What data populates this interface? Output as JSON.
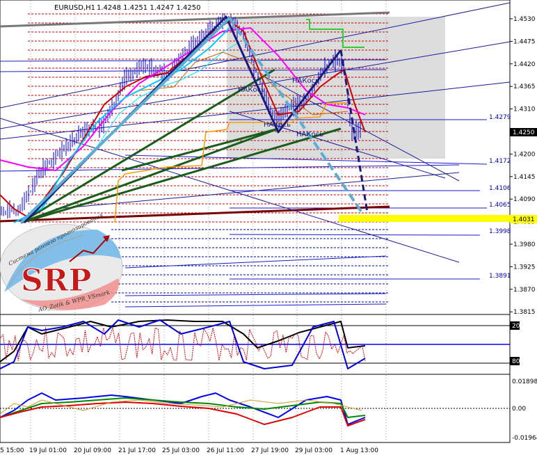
{
  "header": {
    "symbol": "EURUSD,H1",
    "quote": "1.4248 1.4251 1.4247 1.4250"
  },
  "logo": {
    "letters": "SRP",
    "ring_top": "Система раннего прогнозирования",
    "ring_bottom": "AO_Zotik & WPR_VSmark"
  },
  "annotations": {
    "nakos": [
      "НАКось",
      "НАКось",
      "НАКось",
      "НАКось"
    ]
  },
  "price_axis": {
    "ticks": [
      "1.4530",
      "1.4475",
      "1.4420",
      "1.4365",
      "1.4310",
      "1.4255",
      "1.4200",
      "1.4145",
      "1.4090",
      "1.4035",
      "1.3980",
      "1.3925",
      "1.3870",
      "1.3815"
    ],
    "current": "1.4250",
    "highlight": "1.4031"
  },
  "levels": [
    "1.4279",
    "1.4172",
    "1.4106",
    "1.4065",
    "1.3998",
    "1.3891"
  ],
  "time_axis": {
    "labels": [
      "5 15:00",
      "19 Jul 01:00",
      "20 Jul 09:00",
      "21 Jul 17:00",
      "25 Jul 03:00",
      "26 Jul 11:00",
      "27 Jul 19:00",
      "29 Jul 03:00",
      "1 Aug 13:00"
    ]
  },
  "sub1": {
    "top": "20",
    "bottom": "80"
  },
  "sub2": {
    "top": "0.01898",
    "mid": "0.00",
    "bottom": "-0.01964"
  },
  "colors": {
    "price_line": "#0000cc",
    "fast_ma": "#00c8ff",
    "red_ma": "#cc0000",
    "magenta_ma": "#ff00ff",
    "orange": "#ff9900",
    "dark_green": "#1a5c1a",
    "dark_navy": "#1a1a7a",
    "light_blue": "#5aaed6",
    "dark_red": "#7a0000",
    "highlight": "#ffff00",
    "grey_box": "#dcdcdc"
  }
}
